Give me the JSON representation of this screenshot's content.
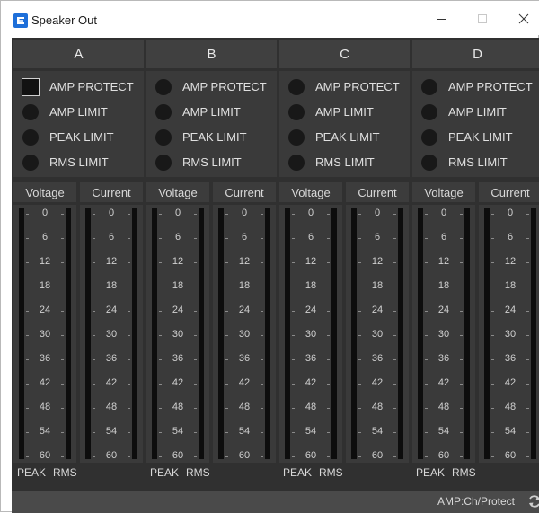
{
  "window": {
    "title": "Speaker Out",
    "app_icon": "speaker-app-icon",
    "controls": [
      "minimize-icon",
      "maximize-icon",
      "close-icon"
    ]
  },
  "indicator_labels": [
    "AMP PROTECT",
    "AMP LIMIT",
    "PEAK LIMIT",
    "RMS LIMIT"
  ],
  "meter_labels": {
    "voltage": "Voltage",
    "current": "Current"
  },
  "scale_ticks": [
    "0",
    "6",
    "12",
    "18",
    "24",
    "30",
    "36",
    "42",
    "48",
    "54",
    "60"
  ],
  "bottom_labels": {
    "peak": "PEAK",
    "rms": "RMS"
  },
  "channels": [
    {
      "name": "A",
      "indicators_on": [
        false,
        false,
        false,
        false
      ],
      "voltage_level": 0,
      "current_level": 0
    },
    {
      "name": "B",
      "indicators_on": [
        false,
        false,
        false,
        false
      ],
      "voltage_level": 0,
      "current_level": 0
    },
    {
      "name": "C",
      "indicators_on": [
        false,
        false,
        false,
        false
      ],
      "voltage_level": 0,
      "current_level": 0
    },
    {
      "name": "D",
      "indicators_on": [
        false,
        false,
        false,
        false
      ],
      "voltage_level": 0,
      "current_level": 0
    }
  ],
  "status": {
    "text": "AMP:Ch/Protect",
    "icon": "refresh-icon"
  },
  "colors": {
    "panel_bg": "#303030",
    "header_bg": "#404040",
    "led_off": "#181818",
    "accent": "#1e6fd9"
  }
}
